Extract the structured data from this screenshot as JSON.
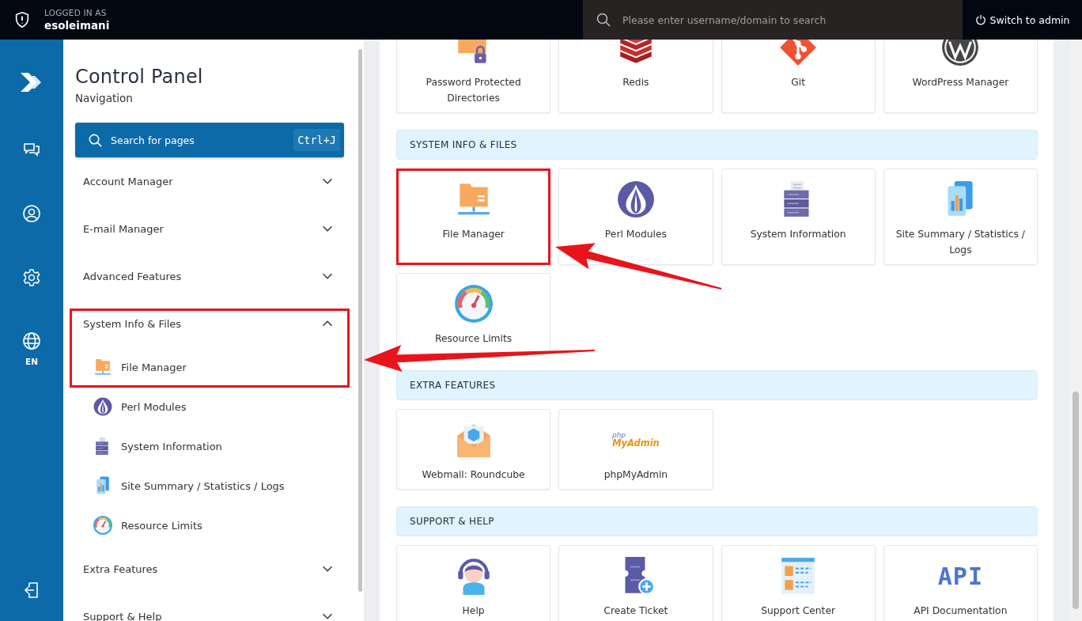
{
  "topbar": {
    "logged_in_label": "LOGGED IN AS",
    "username": "esoleimani",
    "search_placeholder": "Please enter username/domain to search",
    "switch_button": "Switch to admin"
  },
  "rail": {
    "language": "EN"
  },
  "sidebar": {
    "title": "Control Panel",
    "subtitle": "Navigation",
    "search": {
      "placeholder": "Search for pages",
      "shortcut": "Ctrl+J"
    },
    "groups": [
      {
        "label": "Account Manager",
        "expanded": false,
        "highlighted": false
      },
      {
        "label": "E-mail Manager",
        "expanded": false,
        "highlighted": false
      },
      {
        "label": "Advanced Features",
        "expanded": false,
        "highlighted": false
      },
      {
        "label": "System Info & Files",
        "expanded": true,
        "highlighted": true,
        "children": [
          {
            "label": "File Manager",
            "kind": "folder",
            "highlighted": true
          },
          {
            "label": "Perl Modules",
            "kind": "onion",
            "highlighted": false
          },
          {
            "label": "System Information",
            "kind": "server",
            "highlighted": false
          },
          {
            "label": "Site Summary / Statistics / Logs",
            "kind": "chart",
            "highlighted": false
          },
          {
            "label": "Resource Limits",
            "kind": "gauge",
            "highlighted": false
          }
        ]
      },
      {
        "label": "Extra Features",
        "expanded": false,
        "highlighted": false
      },
      {
        "label": "Support & Help",
        "expanded": false,
        "highlighted": false
      }
    ]
  },
  "content": {
    "sections": [
      {
        "cards": [
          {
            "label": "Password Protected Directories",
            "kind": "folder-lock",
            "highlighted": false
          },
          {
            "label": "Redis",
            "kind": "stack",
            "highlighted": false
          },
          {
            "label": "Git",
            "kind": "branch",
            "highlighted": false
          },
          {
            "label": "WordPress Manager",
            "kind": "ring",
            "highlighted": false
          }
        ]
      },
      {
        "title": "SYSTEM INFO & FILES",
        "cards": [
          {
            "label": "File Manager",
            "kind": "folder",
            "highlighted": true
          },
          {
            "label": "Perl Modules",
            "kind": "onion",
            "highlighted": false
          },
          {
            "label": "System Information",
            "kind": "server",
            "highlighted": false
          },
          {
            "label": "Site Summary / Statistics / Logs",
            "kind": "chart",
            "highlighted": false
          },
          {
            "label": "Resource Limits",
            "kind": "gauge",
            "highlighted": false
          }
        ]
      },
      {
        "title": "EXTRA FEATURES",
        "cards": [
          {
            "label": "Webmail: Roundcube",
            "kind": "envelope",
            "highlighted": false
          },
          {
            "label": "phpMyAdmin",
            "kind": "logo",
            "logo": [
              "php",
              "MyAdmin"
            ],
            "highlighted": false
          }
        ]
      },
      {
        "title": "SUPPORT & HELP",
        "cards": [
          {
            "label": "Help",
            "kind": "headset",
            "highlighted": false
          },
          {
            "label": "Create Ticket",
            "kind": "ticket",
            "highlighted": false
          },
          {
            "label": "Support Center",
            "kind": "faq",
            "highlighted": false
          },
          {
            "label": "API Documentation",
            "kind": "text-logo",
            "logo": [
              "API"
            ],
            "highlighted": false
          }
        ]
      }
    ]
  }
}
